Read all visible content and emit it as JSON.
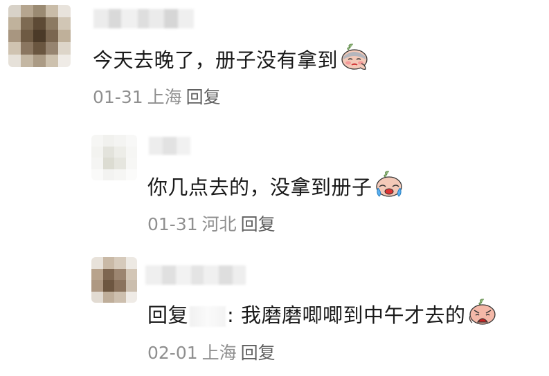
{
  "comments": [
    {
      "text": "今天去晚了，册子没有拿到",
      "emoji": "crying-face-icon",
      "date": "01-31",
      "location": "上海",
      "reply_label": "回复"
    },
    {
      "text": "你几点去的，没拿到册子",
      "emoji": "loudly-crying-face-icon",
      "date": "01-31",
      "location": "河北",
      "reply_label": "回复"
    },
    {
      "reply_prefix": "回复",
      "text": ": 我磨磨唧唧到中午才去的",
      "emoji": "anguished-face-icon",
      "date": "02-01",
      "location": "上海",
      "reply_label": "回复"
    }
  ]
}
